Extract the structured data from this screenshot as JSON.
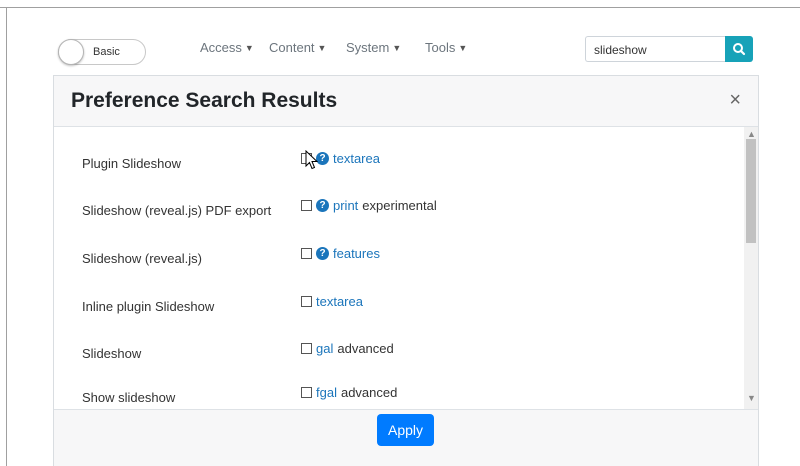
{
  "toggle": {
    "label": "Basic"
  },
  "nav": [
    {
      "label": "Access"
    },
    {
      "label": "Content"
    },
    {
      "label": "System"
    },
    {
      "label": "Tools"
    }
  ],
  "search": {
    "value": "slideshow",
    "icon": "search-icon"
  },
  "modal": {
    "title": "Preference Search Results",
    "close_glyph": "×",
    "rows": [
      {
        "label": "Plugin Slideshow",
        "help": true,
        "link": "textarea",
        "extra": ""
      },
      {
        "label": "Slideshow (reveal.js) PDF export",
        "help": true,
        "link": "print",
        "extra": "experimental"
      },
      {
        "label": "Slideshow (reveal.js)",
        "help": true,
        "link": "features",
        "extra": ""
      },
      {
        "label": "Inline plugin Slideshow",
        "help": false,
        "link": "textarea",
        "extra": ""
      },
      {
        "label": "Slideshow",
        "help": false,
        "link": "gal",
        "extra": "advanced"
      },
      {
        "label": "Show slideshow",
        "help": false,
        "link": "fgal",
        "extra": "advanced"
      }
    ],
    "apply_label": "Apply"
  },
  "colors": {
    "primary": "#007bff",
    "search_button": "#17a2b8",
    "link": "#1b75bb"
  }
}
